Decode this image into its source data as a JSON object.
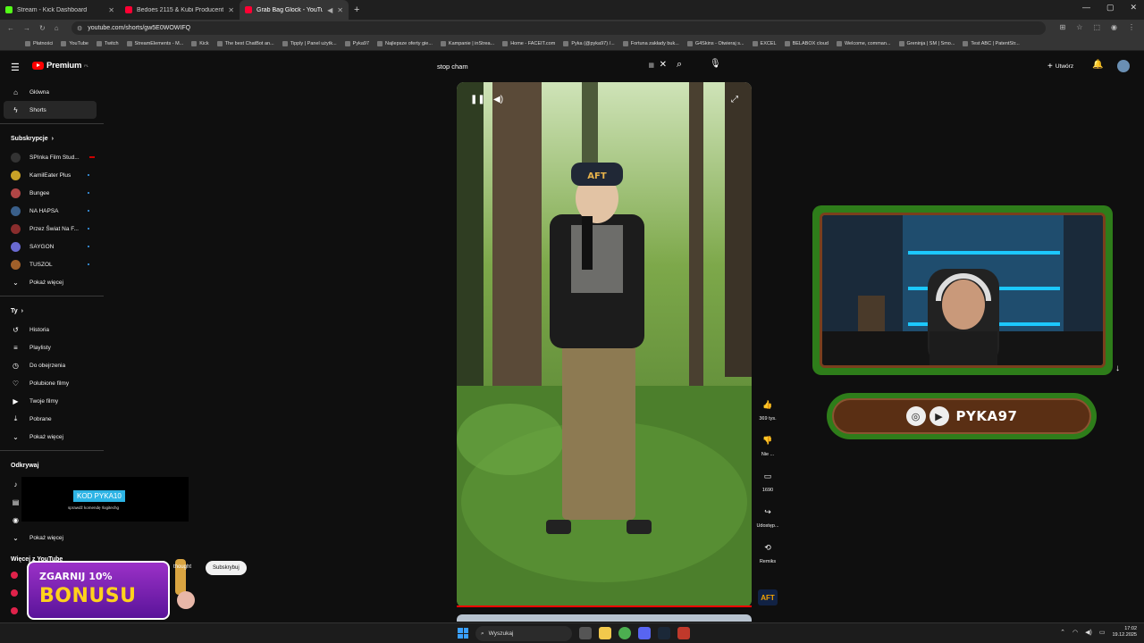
{
  "browser": {
    "tabs": [
      {
        "title": "Stream - Kick Dashboard",
        "color": "#53fc18",
        "active": false
      },
      {
        "title": "Bedoes 2115 & Kubi Producent",
        "color": "#ff0033",
        "active": false
      },
      {
        "title": "Grab Bag Glock - YouTube",
        "color": "#ff0033",
        "active": true
      }
    ],
    "url": "youtube.com/shorts/gw5E0WOWIFQ",
    "bookmarks": [
      "Płatności",
      "YouTube",
      "Twitch",
      "StreamElements - M...",
      "Kick",
      "The best ChatBot an...",
      "Tipply | Panel użytk...",
      "Pyka97",
      "Najlepsze oferty gie...",
      "Kampanie | inStrea...",
      "Home - FACEIT.com",
      "Pyka (@pyka97) /...",
      "Fortuna zakłady buk...",
      "G4Skins - Otwieraj s...",
      "EXCEL",
      "BELABOX cloud",
      "Welcome, comman...",
      "Greninja | SM | Smo...",
      "Test ABC | PatentStr..."
    ]
  },
  "header": {
    "logo_text": "Premium",
    "logo_region": "PL",
    "search_value": "stop cham",
    "create_label": "Utwórz"
  },
  "sidebar": {
    "main": [
      {
        "label": "Główna",
        "icon": "home-icon",
        "glyph": "⌂"
      },
      {
        "label": "Shorts",
        "icon": "shorts-icon",
        "glyph": "ϟ"
      }
    ],
    "subscriptions_title": "Subskrypcje",
    "subscriptions": [
      {
        "label": "SPInka Film Stud...",
        "color": "#333"
      },
      {
        "label": "KamilEater Plus",
        "color": "#c9a227"
      },
      {
        "label": "Bungee",
        "color": "#b04646"
      },
      {
        "label": "NA HAPSA",
        "color": "#3a5f8a"
      },
      {
        "label": "Przez Świat Na F...",
        "color": "#8a2d2d"
      },
      {
        "label": "SAYGON",
        "color": "#6a6ad1"
      },
      {
        "label": "TUSZOL",
        "color": "#a0602a"
      }
    ],
    "show_more": "Pokaż więcej",
    "you_title": "Ty",
    "you_items": [
      {
        "label": "Historia",
        "glyph": "↺"
      },
      {
        "label": "Playlisty",
        "glyph": "≡"
      },
      {
        "label": "Do obejrzenia",
        "glyph": "◷"
      },
      {
        "label": "Polubione filmy",
        "glyph": "♡"
      },
      {
        "label": "Twoje filmy",
        "glyph": "▶"
      },
      {
        "label": "Pobrane",
        "glyph": "⤓"
      }
    ],
    "discover_title": "Odkrywaj",
    "more_youtube_title": "Więcej z YouTube"
  },
  "overlay": {
    "code_label": "KOD PYKA10",
    "code_sub": "sprawdź komendę !logitechg",
    "bonus_line1": "ZGARNIJ 10%",
    "bonus_line2": "BONUSU",
    "thought_text": "thought",
    "subscribe_label": "Subskrybuj",
    "streamer_name": "PYKA97"
  },
  "actions": {
    "likes": "369 tys.",
    "dislike": "Nie ...",
    "comments": "1690",
    "share": "Udostęp...",
    "remix": "Remiks",
    "channel_badge": "AFT"
  },
  "video": {
    "patch_text": "AFT"
  },
  "taskbar": {
    "search_placeholder": "Wyszukaj",
    "time": "17:02",
    "date": "19.12.2025"
  }
}
